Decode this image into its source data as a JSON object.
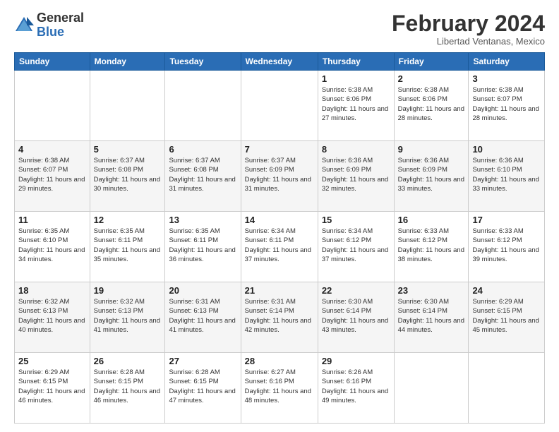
{
  "logo": {
    "general": "General",
    "blue": "Blue"
  },
  "header": {
    "title": "February 2024",
    "subtitle": "Libertad Ventanas, Mexico"
  },
  "weekdays": [
    "Sunday",
    "Monday",
    "Tuesday",
    "Wednesday",
    "Thursday",
    "Friday",
    "Saturday"
  ],
  "rows": [
    [
      {
        "day": "",
        "info": ""
      },
      {
        "day": "",
        "info": ""
      },
      {
        "day": "",
        "info": ""
      },
      {
        "day": "",
        "info": ""
      },
      {
        "day": "1",
        "info": "Sunrise: 6:38 AM\nSunset: 6:06 PM\nDaylight: 11 hours and 27 minutes."
      },
      {
        "day": "2",
        "info": "Sunrise: 6:38 AM\nSunset: 6:06 PM\nDaylight: 11 hours and 28 minutes."
      },
      {
        "day": "3",
        "info": "Sunrise: 6:38 AM\nSunset: 6:07 PM\nDaylight: 11 hours and 28 minutes."
      }
    ],
    [
      {
        "day": "4",
        "info": "Sunrise: 6:38 AM\nSunset: 6:07 PM\nDaylight: 11 hours and 29 minutes."
      },
      {
        "day": "5",
        "info": "Sunrise: 6:37 AM\nSunset: 6:08 PM\nDaylight: 11 hours and 30 minutes."
      },
      {
        "day": "6",
        "info": "Sunrise: 6:37 AM\nSunset: 6:08 PM\nDaylight: 11 hours and 31 minutes."
      },
      {
        "day": "7",
        "info": "Sunrise: 6:37 AM\nSunset: 6:09 PM\nDaylight: 11 hours and 31 minutes."
      },
      {
        "day": "8",
        "info": "Sunrise: 6:36 AM\nSunset: 6:09 PM\nDaylight: 11 hours and 32 minutes."
      },
      {
        "day": "9",
        "info": "Sunrise: 6:36 AM\nSunset: 6:09 PM\nDaylight: 11 hours and 33 minutes."
      },
      {
        "day": "10",
        "info": "Sunrise: 6:36 AM\nSunset: 6:10 PM\nDaylight: 11 hours and 33 minutes."
      }
    ],
    [
      {
        "day": "11",
        "info": "Sunrise: 6:35 AM\nSunset: 6:10 PM\nDaylight: 11 hours and 34 minutes."
      },
      {
        "day": "12",
        "info": "Sunrise: 6:35 AM\nSunset: 6:11 PM\nDaylight: 11 hours and 35 minutes."
      },
      {
        "day": "13",
        "info": "Sunrise: 6:35 AM\nSunset: 6:11 PM\nDaylight: 11 hours and 36 minutes."
      },
      {
        "day": "14",
        "info": "Sunrise: 6:34 AM\nSunset: 6:11 PM\nDaylight: 11 hours and 37 minutes."
      },
      {
        "day": "15",
        "info": "Sunrise: 6:34 AM\nSunset: 6:12 PM\nDaylight: 11 hours and 37 minutes."
      },
      {
        "day": "16",
        "info": "Sunrise: 6:33 AM\nSunset: 6:12 PM\nDaylight: 11 hours and 38 minutes."
      },
      {
        "day": "17",
        "info": "Sunrise: 6:33 AM\nSunset: 6:12 PM\nDaylight: 11 hours and 39 minutes."
      }
    ],
    [
      {
        "day": "18",
        "info": "Sunrise: 6:32 AM\nSunset: 6:13 PM\nDaylight: 11 hours and 40 minutes."
      },
      {
        "day": "19",
        "info": "Sunrise: 6:32 AM\nSunset: 6:13 PM\nDaylight: 11 hours and 41 minutes."
      },
      {
        "day": "20",
        "info": "Sunrise: 6:31 AM\nSunset: 6:13 PM\nDaylight: 11 hours and 41 minutes."
      },
      {
        "day": "21",
        "info": "Sunrise: 6:31 AM\nSunset: 6:14 PM\nDaylight: 11 hours and 42 minutes."
      },
      {
        "day": "22",
        "info": "Sunrise: 6:30 AM\nSunset: 6:14 PM\nDaylight: 11 hours and 43 minutes."
      },
      {
        "day": "23",
        "info": "Sunrise: 6:30 AM\nSunset: 6:14 PM\nDaylight: 11 hours and 44 minutes."
      },
      {
        "day": "24",
        "info": "Sunrise: 6:29 AM\nSunset: 6:15 PM\nDaylight: 11 hours and 45 minutes."
      }
    ],
    [
      {
        "day": "25",
        "info": "Sunrise: 6:29 AM\nSunset: 6:15 PM\nDaylight: 11 hours and 46 minutes."
      },
      {
        "day": "26",
        "info": "Sunrise: 6:28 AM\nSunset: 6:15 PM\nDaylight: 11 hours and 46 minutes."
      },
      {
        "day": "27",
        "info": "Sunrise: 6:28 AM\nSunset: 6:15 PM\nDaylight: 11 hours and 47 minutes."
      },
      {
        "day": "28",
        "info": "Sunrise: 6:27 AM\nSunset: 6:16 PM\nDaylight: 11 hours and 48 minutes."
      },
      {
        "day": "29",
        "info": "Sunrise: 6:26 AM\nSunset: 6:16 PM\nDaylight: 11 hours and 49 minutes."
      },
      {
        "day": "",
        "info": ""
      },
      {
        "day": "",
        "info": ""
      }
    ]
  ]
}
